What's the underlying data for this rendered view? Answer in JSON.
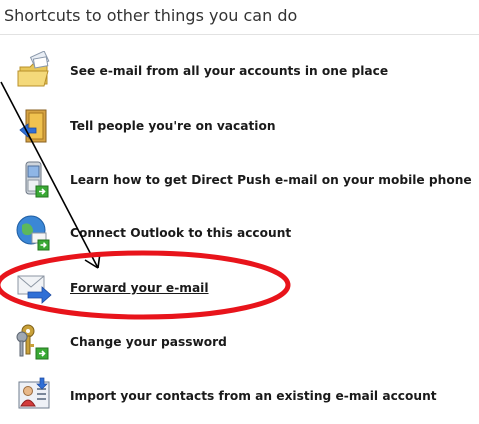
{
  "heading": "Shortcuts to other things you can do",
  "items": [
    {
      "label": "See e-mail from all your accounts in one place",
      "icon": "folder-mail-icon"
    },
    {
      "label": "Tell people you're on vacation",
      "icon": "door-exit-icon"
    },
    {
      "label": "Learn how to get Direct Push e-mail on your mobile phone",
      "icon": "mobile-phone-icon"
    },
    {
      "label": "Connect Outlook to this account",
      "icon": "globe-outlook-icon"
    },
    {
      "label": "Forward your e-mail",
      "icon": "envelope-forward-icon"
    },
    {
      "label": "Change your password",
      "icon": "keys-icon"
    },
    {
      "label": "Import your contacts from an existing e-mail account",
      "icon": "contact-card-icon"
    }
  ],
  "colors": {
    "annotation_ellipse": "#e8141b",
    "annotation_arrow": "#000000",
    "forward_arrow_green": "#3aa935",
    "forward_arrow_blue": "#2f6fd6"
  }
}
